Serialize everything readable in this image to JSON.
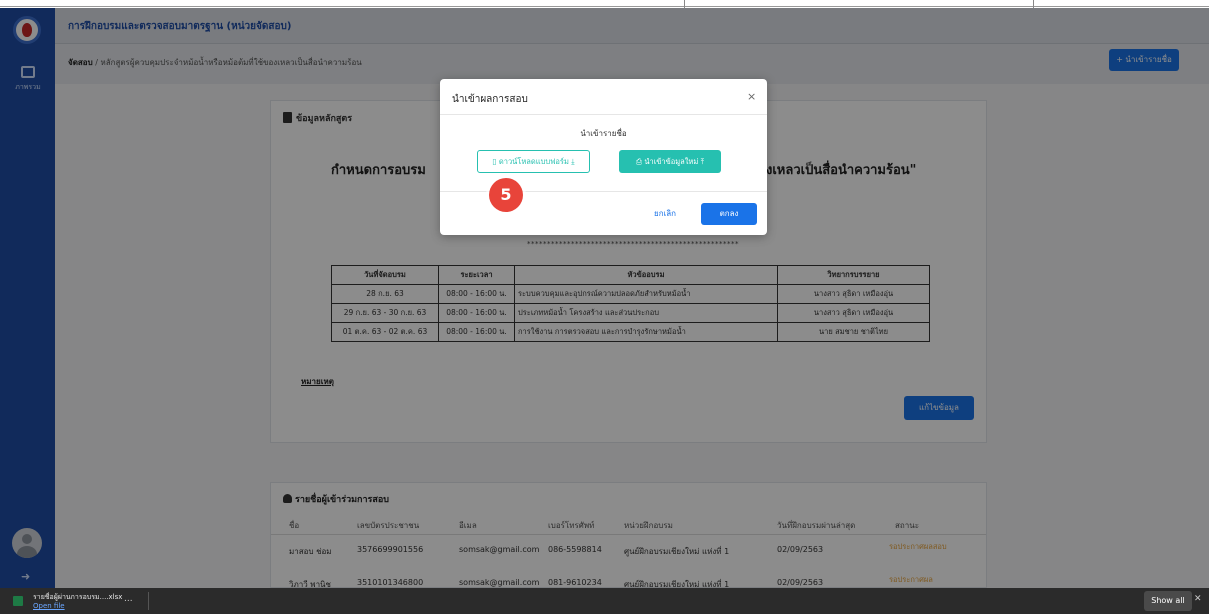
{
  "header": {
    "app_title": "การฝึกอบรมและตรวจสอบมาตรฐาน (หน่วยจัดสอบ)",
    "breadcrumb_root": "จัดสอบ",
    "breadcrumb_path": " / หลักสูตรผู้ควบคุมประจำหม้อน้ำหรือหม้อต้มที่ใช้ของเหลวเป็นสื่อนำความร้อน",
    "import_button": "+ นำเข้ารายชื่อ"
  },
  "sidebar": {
    "nav_label": "ภาพรวม"
  },
  "course_card": {
    "title": "ข้อมูลหลักสูตร",
    "headline_left": "กำหนดการอบรม",
    "headline_right": "งเหลวเป็นสื่อนำความร้อน\"",
    "stars": "*****************************************************",
    "table_headers": [
      "วันที่จัดอบรม",
      "ระยะเวลา",
      "หัวข้ออบรม",
      "วิทยากรบรรยาย"
    ],
    "table_rows": [
      [
        "28 ก.ย. 63",
        "08:00 - 16:00 น.",
        "ระบบควบคุมและอุปกรณ์ความปลอดภัยสำหรับหม้อน้ำ",
        "นางสาว สุธิดา เหมืองอุ่น"
      ],
      [
        "29 ก.ย. 63 - 30 ก.ย. 63",
        "08:00 - 16:00 น.",
        "ประเภทหม้อน้ำ โครงสร้าง และส่วนประกอบ",
        "นางสาว สุธิดา เหมืองอุ่น"
      ],
      [
        "01 ต.ค. 63 - 02 ต.ค. 63",
        "08:00 - 16:00 น.",
        "การใช้งาน การตรวจสอบ และการบำรุงรักษาหม้อน้ำ",
        "นาย สมชาย ชาติไทย"
      ]
    ],
    "note_label": "หมายเหตุ",
    "edit_button": "แก้ไขข้อมูล"
  },
  "participants": {
    "title": "รายชื่อผู้เข้าร่วมการสอบ",
    "columns": [
      "ชื่อ",
      "เลขบัตรประชาชน",
      "อีเมล",
      "เบอร์โทรศัพท์",
      "หน่วยฝึกอบรม",
      "วันที่ฝึกอบรมผ่านล่าสุด",
      "สถานะ"
    ],
    "rows": [
      [
        "มาสอบ ช่อม",
        "3576699901556",
        "somsak@gmail.com",
        "086-5598814",
        "ศูนย์ฝึกอบรมเชียงใหม่ แห่งที่ 1",
        "02/09/2563",
        "รอประกาศผลสอบ"
      ],
      [
        "วิภาวี พานิช",
        "3510101346800",
        "somsak@gmail.com",
        "081-9610234",
        "ศูนย์ฝึกอบรมเชียงใหม่ แห่งที่ 1",
        "02/09/2563",
        "รอประกาศผล"
      ]
    ]
  },
  "modal": {
    "title": "นำเข้าผลการสอบ",
    "close": "×",
    "subtitle": "นำเข้ารายชื่อ",
    "download_button": "ดาวน์โหลดแบบฟอร์ม",
    "import_button": "นำเข้าข้อมูลใหม่",
    "cancel": "ยกเลิก",
    "ok": "ตกลง"
  },
  "step_badge": "5",
  "download_bar": {
    "file_name": "รายชื่อผู้ผ่านการอบรม....xlsx",
    "open_file": "Open file",
    "more": "...",
    "show_all": "Show all",
    "close": "✕"
  }
}
